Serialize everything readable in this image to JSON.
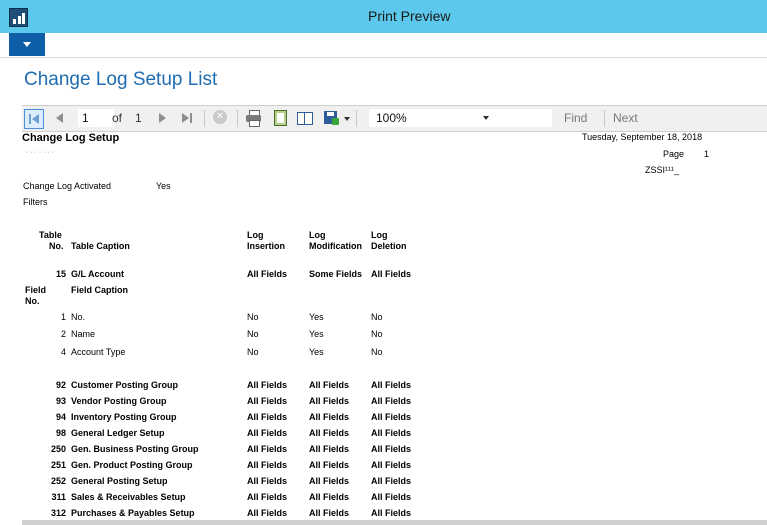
{
  "window": {
    "title": "Print Preview"
  },
  "page_title": "Change Log Setup List",
  "toolbar": {
    "page_current": "1",
    "of_label": "of",
    "page_total": "1",
    "zoom": "100%",
    "find_label": "Find",
    "next_label": "Next"
  },
  "report": {
    "title": "Change Log Setup",
    "date": "Tuesday, September 18, 2018",
    "page_label": "Page",
    "page_number": "1",
    "user": "ZSSI¹¹¹_",
    "company": "· · · · · · ·",
    "activated_label": "Change Log Activated",
    "activated_value": "Yes",
    "filters_label": "Filters",
    "headers": {
      "table_no_1": "Table",
      "table_no_2": "No.",
      "table_caption": "Table Caption",
      "log_insertion_1": "Log",
      "log_insertion_2": "Insertion",
      "log_modification_1": "Log",
      "log_modification_2": "Modification",
      "log_deletion_1": "Log",
      "log_deletion_2": "Deletion"
    },
    "first_table": {
      "no": "15",
      "caption": "G/L Account",
      "insertion": "All Fields",
      "modification": "Some Fields",
      "deletion": "All Fields"
    },
    "field_headers": {
      "field_no_1": "Field",
      "field_no_2": "No.",
      "field_caption": "Field Caption"
    },
    "fields": [
      {
        "no": "1",
        "caption": "No.",
        "insertion": "No",
        "modification": "Yes",
        "deletion": "No"
      },
      {
        "no": "2",
        "caption": "Name",
        "insertion": "No",
        "modification": "Yes",
        "deletion": "No"
      },
      {
        "no": "4",
        "caption": "Account Type",
        "insertion": "No",
        "modification": "Yes",
        "deletion": "No"
      }
    ],
    "tables": [
      {
        "no": "92",
        "caption": "Customer Posting Group",
        "insertion": "All Fields",
        "modification": "All Fields",
        "deletion": "All Fields"
      },
      {
        "no": "93",
        "caption": "Vendor Posting Group",
        "insertion": "All Fields",
        "modification": "All Fields",
        "deletion": "All Fields"
      },
      {
        "no": "94",
        "caption": "Inventory Posting Group",
        "insertion": "All Fields",
        "modification": "All Fields",
        "deletion": "All Fields"
      },
      {
        "no": "98",
        "caption": "General Ledger Setup",
        "insertion": "All Fields",
        "modification": "All Fields",
        "deletion": "All Fields"
      },
      {
        "no": "250",
        "caption": "Gen. Business Posting Group",
        "insertion": "All Fields",
        "modification": "All Fields",
        "deletion": "All Fields"
      },
      {
        "no": "251",
        "caption": "Gen. Product Posting Group",
        "insertion": "All Fields",
        "modification": "All Fields",
        "deletion": "All Fields"
      },
      {
        "no": "252",
        "caption": "General Posting Setup",
        "insertion": "All Fields",
        "modification": "All Fields",
        "deletion": "All Fields"
      },
      {
        "no": "311",
        "caption": "Sales & Receivables Setup",
        "insertion": "All Fields",
        "modification": "All Fields",
        "deletion": "All Fields"
      },
      {
        "no": "312",
        "caption": "Purchases & Payables Setup",
        "insertion": "All Fields",
        "modification": "All Fields",
        "deletion": "All Fields"
      }
    ]
  }
}
